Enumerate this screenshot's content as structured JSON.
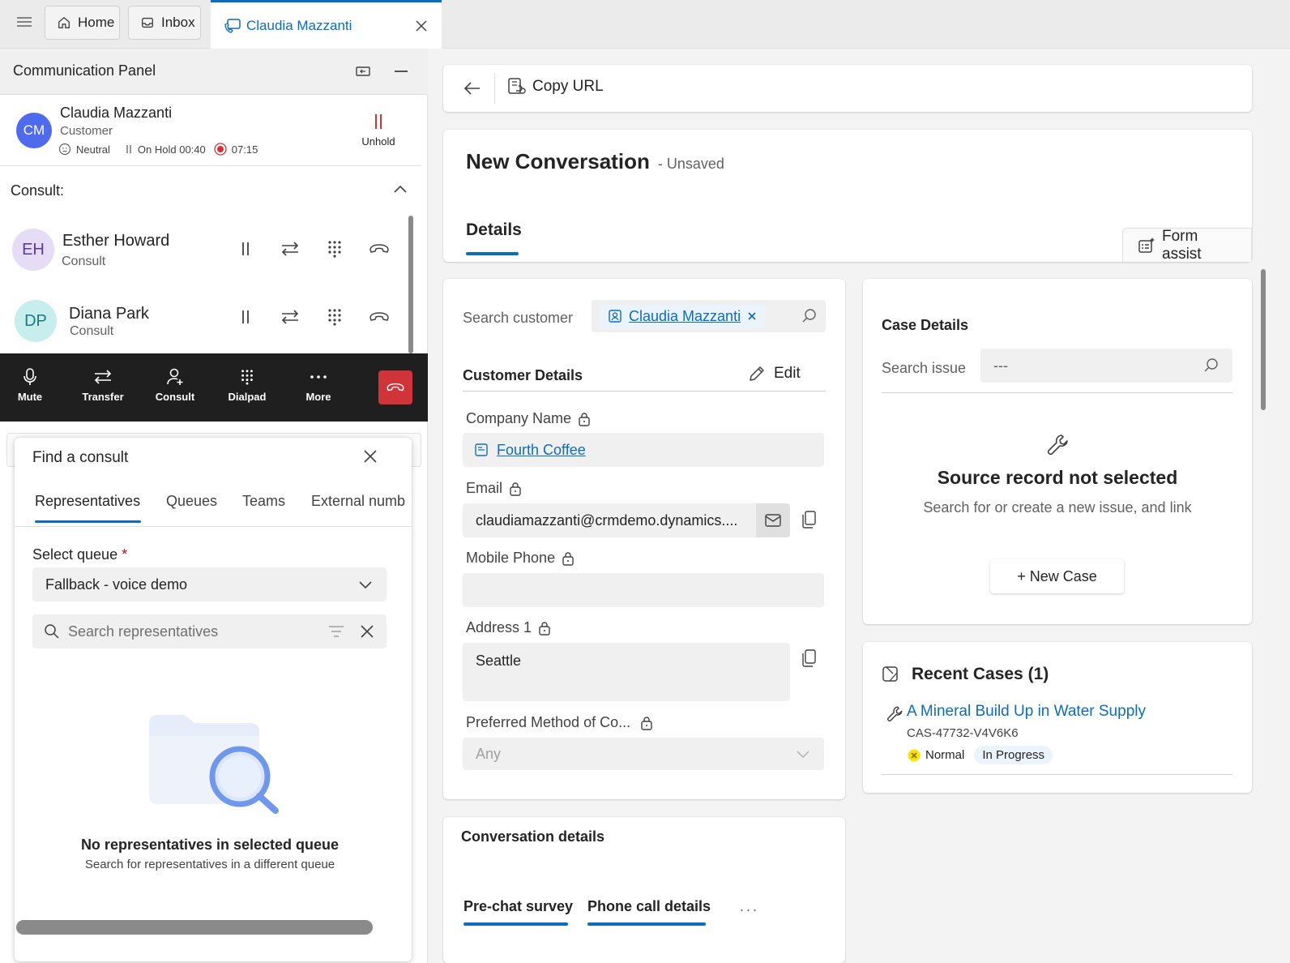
{
  "tabs": {
    "home_label": "Home",
    "inbox_label": "Inbox",
    "active_label": "Claudia Mazzanti"
  },
  "comm_panel": {
    "title": "Communication Panel",
    "customer": {
      "initials": "CM",
      "name": "Claudia Mazzanti",
      "role": "Customer",
      "sentiment": "Neutral",
      "hold_status": "On Hold 00:40",
      "call_timer": "07:15",
      "unhold_label": "Unhold"
    },
    "consult_heading": "Consult:",
    "consultants": [
      {
        "initials": "EH",
        "name": "Esther Howard",
        "role": "Consult"
      },
      {
        "initials": "DP",
        "name": "Diana Park",
        "role": "Consult"
      }
    ],
    "call_controls": {
      "mute": "Mute",
      "transfer": "Transfer",
      "consult": "Consult",
      "dialpad": "Dialpad",
      "more": "More"
    }
  },
  "find_consult": {
    "title": "Find a consult",
    "tabs": [
      "Representatives",
      "Queues",
      "Teams",
      "External numb"
    ],
    "select_queue_label": "Select queue",
    "required_mark": "*",
    "queue_value": "Fallback - voice demo",
    "search_placeholder": "Search representatives",
    "empty_title": "No representatives in selected queue",
    "empty_subtitle": "Search for representatives in a different queue"
  },
  "commandbar": {
    "copy_url": "Copy URL"
  },
  "form": {
    "title": "New Conversation",
    "status": "- Unsaved",
    "tab_details": "Details",
    "form_assist": "Form assist"
  },
  "customer_card": {
    "search_label": "Search customer",
    "customer_value": "Claudia Mazzanti",
    "section_title": "Customer Details",
    "edit_label": "Edit",
    "company_label": "Company Name",
    "company_value": "Fourth Coffee",
    "email_label": "Email",
    "email_value": "claudiamazzanti@crmdemo.dynamics....",
    "mobile_label": "Mobile Phone",
    "mobile_value": "",
    "address_label": "Address 1",
    "address_value": "Seattle",
    "preferred_label": "Preferred Method of Co...",
    "preferred_value": "Any"
  },
  "case_card": {
    "title": "Case Details",
    "search_issue_label": "Search issue",
    "search_issue_value": "---",
    "empty_title": "Source record not selected",
    "empty_subtitle": "Search for or create a new issue, and link",
    "new_case_label": "+ New Case"
  },
  "recent_cases": {
    "title": "Recent Cases (1)",
    "items": [
      {
        "title": "A Mineral Build Up in Water Supply",
        "id": "CAS-47732-V4V6K6",
        "priority": "Normal",
        "status": "In Progress"
      }
    ]
  },
  "conversation_details": {
    "title": "Conversation details",
    "tabs": [
      "Pre-chat survey",
      "Phone call details"
    ],
    "more": "..."
  },
  "colors": {
    "accent": "#0f6cbd",
    "danger": "#d13438",
    "call_bar": "#1f1f1f"
  }
}
